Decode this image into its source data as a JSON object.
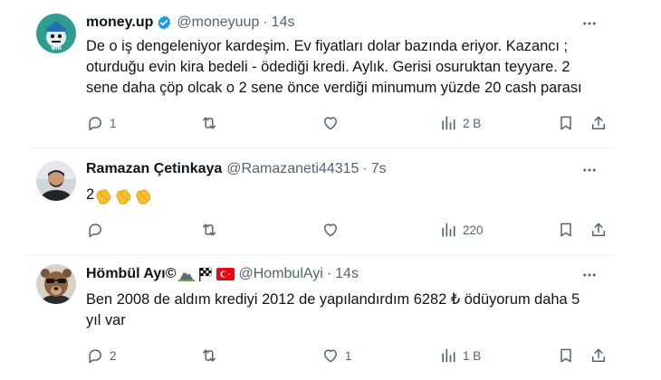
{
  "tweets": [
    {
      "name": "money.up",
      "handle": "@moneyuup",
      "time": "14s",
      "text": "De o iş dengeleniyor kardeşim. Ev fiyatları dolar bazında eriyor. Kazancı ;\noturduğu evin kira bedeli - ödediği kredi. Aylık. Gerisi osuruktan teyyare. 2\nsene daha çöp olcak o 2 sene önce verdiği minumum yüzde 20 cash parası",
      "replies": "1",
      "retweets": "",
      "likes": "",
      "views": "2 B"
    },
    {
      "name": "Ramazan Çetinkaya",
      "handle": "@Ramazaneti44315",
      "time": "7s",
      "text": "2",
      "replies": "",
      "retweets": "",
      "likes": "",
      "views": "220"
    },
    {
      "name": "Hömbül Ayı©",
      "handle": "@HombulAyi",
      "time": "14s",
      "text": "Ben 2008 de aldım krediyi 2012 de yapılandırdım 6282 ₺ ödüyorum daha 5\nyıl var",
      "replies": "2",
      "retweets": "",
      "likes": "1",
      "views": "1 B"
    }
  ],
  "colors": {
    "text": "#0f1419",
    "secondary": "#536471",
    "verified": "#1d9bf0",
    "divider": "#eff3f4"
  },
  "icons": [
    "verified-badge-icon",
    "more-icon",
    "reply-icon",
    "retweet-icon",
    "like-icon",
    "views-icon",
    "bookmark-icon",
    "share-icon",
    "clapping-hands-icon",
    "mountain-emoji-icon",
    "checkered-flag-icon",
    "turkey-flag-icon"
  ]
}
